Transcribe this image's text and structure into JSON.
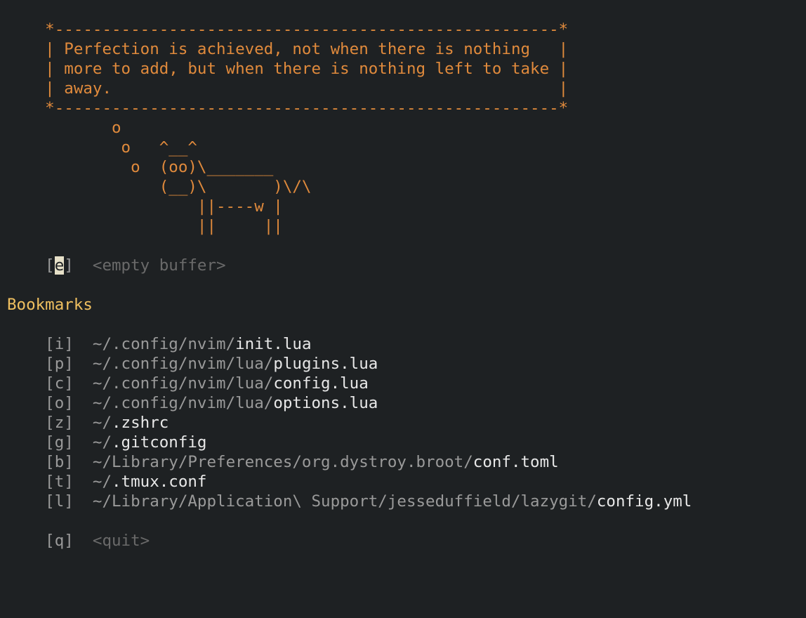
{
  "cowsay": {
    "lines": [
      "    *-----------------------------------------------------*",
      "    | Perfection is achieved, not when there is nothing   |",
      "    | more to add, but when there is nothing left to take |",
      "    | away.                                               |",
      "    *-----------------------------------------------------*",
      "           o",
      "            o   ^__^",
      "             o  (oo)\\_______",
      "                (__)\\       )\\/\\",
      "                    ||----w |",
      "                    ||     ||"
    ]
  },
  "empty_buffer": {
    "bracket_open": "    [",
    "key": "e",
    "bracket_close": "]  ",
    "label": "<empty buffer>"
  },
  "bookmarks": {
    "heading": "Bookmarks",
    "items": [
      {
        "key": "    [i]  ",
        "dir": "~/.config/nvim/",
        "file": "init.lua"
      },
      {
        "key": "    [p]  ",
        "dir": "~/.config/nvim/lua/",
        "file": "plugins.lua"
      },
      {
        "key": "    [c]  ",
        "dir": "~/.config/nvim/lua/",
        "file": "config.lua"
      },
      {
        "key": "    [o]  ",
        "dir": "~/.config/nvim/lua/",
        "file": "options.lua"
      },
      {
        "key": "    [z]  ",
        "dir": "~/",
        "file": ".zshrc"
      },
      {
        "key": "    [g]  ",
        "dir": "~/",
        "file": ".gitconfig"
      },
      {
        "key": "    [b]  ",
        "dir": "~/Library/Preferences/org.dystroy.broot/",
        "file": "conf.toml"
      },
      {
        "key": "    [t]  ",
        "dir": "~/",
        "file": ".tmux.conf"
      },
      {
        "key": "    [l]  ",
        "dir": "~/Library/Application\\ Support/jesseduffield/lazygit/",
        "file": "config.yml"
      }
    ]
  },
  "quit": {
    "key": "    [q]  ",
    "label": "<quit>"
  }
}
